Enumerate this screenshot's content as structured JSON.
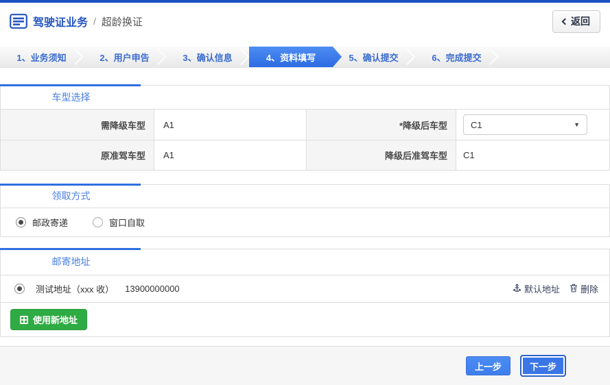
{
  "header": {
    "title": "驾驶证业务",
    "slash": "/",
    "subtitle": "超龄换证",
    "back_label": "返回"
  },
  "steps": [
    {
      "label": "1、业务须知",
      "active": false
    },
    {
      "label": "2、用户申告",
      "active": false
    },
    {
      "label": "3、确认信息",
      "active": false
    },
    {
      "label": "4、资料填写",
      "active": true
    },
    {
      "label": "5、确认提交",
      "active": false
    },
    {
      "label": "6、完成提交",
      "active": false
    }
  ],
  "sections": {
    "vehicle": {
      "title": "车型选择",
      "rows": [
        {
          "label1": "需降级车型",
          "value1": "A1",
          "label2": "*降级后车型",
          "value2": "C1"
        },
        {
          "label1": "原准驾车型",
          "value1": "A1",
          "label2": "降级后准驾车型",
          "value2": "C1"
        }
      ]
    },
    "pickup": {
      "title": "领取方式",
      "options": [
        {
          "label": "邮政寄递",
          "selected": true
        },
        {
          "label": "窗口自取",
          "selected": false
        }
      ]
    },
    "address": {
      "title": "邮寄地址",
      "entry": {
        "selected": true,
        "text": "测试地址（xxx 收）",
        "phone": "13900000000"
      },
      "default_link": "默认地址",
      "delete_link": "删除",
      "new_address_button": "使用新地址"
    }
  },
  "footer": {
    "prev_label": "上一步",
    "next_label": "下一步"
  },
  "colors": {
    "accent_blue": "#2e6fe0",
    "top_bar_blue": "#1c52c2",
    "active_step_blue": "#2c6be2",
    "success_green": "#2fab44",
    "section_title_blue": "#4a80e0"
  }
}
